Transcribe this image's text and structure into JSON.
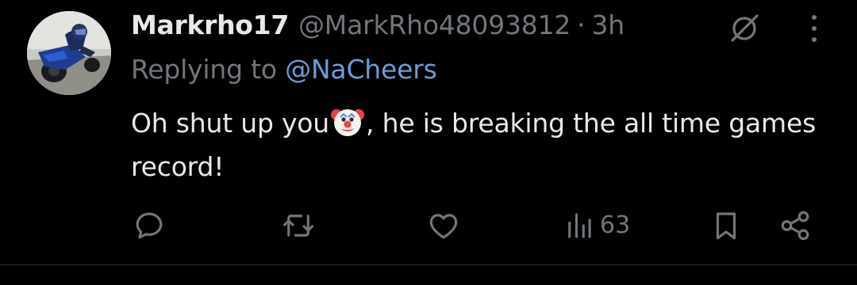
{
  "tweet": {
    "author": {
      "display_name": "Markrho17",
      "handle": "@MarkRho48093812",
      "avatar_icon": "motorcycle-rider-avatar"
    },
    "separator": "·",
    "time": "3h",
    "reply": {
      "prefix": "Replying to ",
      "mention": "@NaCheers"
    },
    "text_before_emoji": "Oh shut up you",
    "emoji": "clown-face-emoji",
    "text_after_emoji": ", he is breaking the all time games record!",
    "actions": {
      "reply_icon": "reply-icon",
      "retweet_icon": "retweet-icon",
      "like_icon": "like-icon",
      "views_icon": "views-icon",
      "views_count": "63",
      "bookmark_icon": "bookmark-icon",
      "share_icon": "share-icon"
    },
    "header_icons": {
      "grok_icon": "grok-icon",
      "more_icon": "more-icon"
    }
  },
  "colors": {
    "background": "#000000",
    "primary_text": "#e7e9ea",
    "secondary_text": "#71767b",
    "link": "#6a9fd8",
    "divider": "#2f3336"
  }
}
